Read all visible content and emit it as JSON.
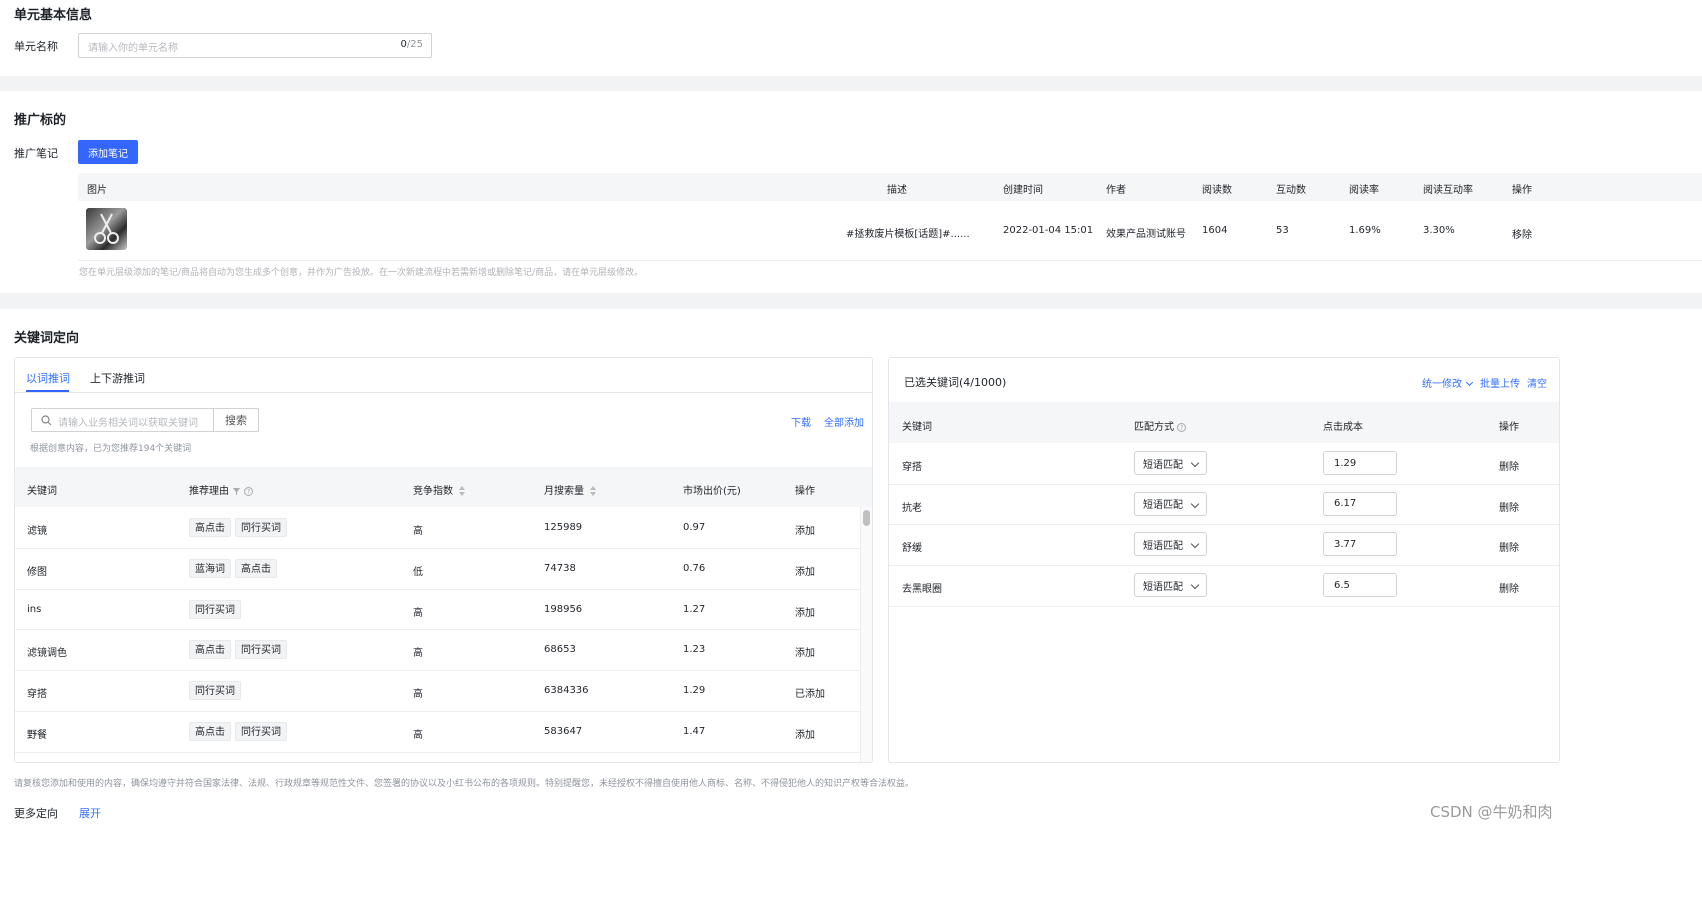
{
  "unit_info": {
    "title": "单元基本信息",
    "name_label": "单元名称",
    "name_placeholder": "请输入你的单元名称",
    "name_count": "0",
    "name_max": "/25"
  },
  "promo": {
    "title": "推广标的",
    "note_label": "推广笔记",
    "add_button": "添加笔记",
    "columns": [
      "图片",
      "描述",
      "创建时间",
      "作者",
      "阅读数",
      "互动数",
      "阅读率",
      "阅读互动率",
      "操作"
    ],
    "row": {
      "desc": "#拯救废片模板[话题]#......",
      "created": "2022-01-04 15:01",
      "author": "效果产品测试账号",
      "reads": "1604",
      "interactions": "53",
      "read_rate": "1.69%",
      "interaction_rate": "3.30%",
      "action": "移除"
    },
    "hint": "您在单元层级添加的笔记/商品将自动为您生成多个创意，并作为广告投放。在一次新建流程中若需新增或删除笔记/商品，请在单元层级修改。"
  },
  "keywords": {
    "title": "关键词定向",
    "tabs": [
      "以词推词",
      "上下游推词"
    ],
    "search_placeholder": "请输入业务相关词以获取关键词",
    "search_button": "搜索",
    "download": "下载",
    "add_all": "全部添加",
    "recommend_note": "根据创意内容，已为您推荐194个关键词",
    "columns": [
      "关键词",
      "推荐理由",
      "竞争指数",
      "月搜索量",
      "市场出价(元)",
      "操作"
    ],
    "rows": [
      {
        "kw": "滤镜",
        "tags": [
          "高点击",
          "同行买词"
        ],
        "comp": "高",
        "vol": "125989",
        "price": "0.97",
        "action": "添加"
      },
      {
        "kw": "修图",
        "tags": [
          "蓝海词",
          "高点击"
        ],
        "comp": "低",
        "vol": "74738",
        "price": "0.76",
        "action": "添加"
      },
      {
        "kw": "ins",
        "tags": [
          "同行买词"
        ],
        "comp": "高",
        "vol": "198956",
        "price": "1.27",
        "action": "添加"
      },
      {
        "kw": "滤镜调色",
        "tags": [
          "高点击",
          "同行买词"
        ],
        "comp": "高",
        "vol": "68653",
        "price": "1.23",
        "action": "添加"
      },
      {
        "kw": "穿搭",
        "tags": [
          "同行买词"
        ],
        "comp": "高",
        "vol": "6384336",
        "price": "1.29",
        "action": "已添加"
      },
      {
        "kw": "野餐",
        "tags": [
          "高点击",
          "同行买词"
        ],
        "comp": "高",
        "vol": "583647",
        "price": "1.47",
        "action": "添加"
      }
    ],
    "selected": {
      "title": "已选关键词(4/1000)",
      "bulk_edit": "统一修改",
      "bulk_upload": "批量上传",
      "clear": "清空",
      "columns": [
        "关键词",
        "匹配方式",
        "点击成本",
        "操作"
      ],
      "rows": [
        {
          "kw": "穿搭",
          "match": "短语匹配",
          "cost": "1.29",
          "action": "删除"
        },
        {
          "kw": "抗老",
          "match": "短语匹配",
          "cost": "6.17",
          "action": "删除"
        },
        {
          "kw": "舒缓",
          "match": "短语匹配",
          "cost": "3.77",
          "action": "删除"
        },
        {
          "kw": "去黑眼圈",
          "match": "短语匹配",
          "cost": "6.5",
          "action": "删除"
        }
      ]
    },
    "legal_note": "请复核您添加和使用的内容，确保均遵守并符合国家法律、法规、行政规章等规范性文件、您签署的协议以及小红书公布的各项规则。特别提醒您，未经授权不得擅自使用他人商标、名称、不得侵犯他人的知识产权等合法权益。"
  },
  "more": {
    "label": "更多定向",
    "expand": "展开"
  },
  "watermark": "CSDN @牛奶和肉",
  "colors": {
    "accent": "#3366ff",
    "link": "#3370ff"
  }
}
